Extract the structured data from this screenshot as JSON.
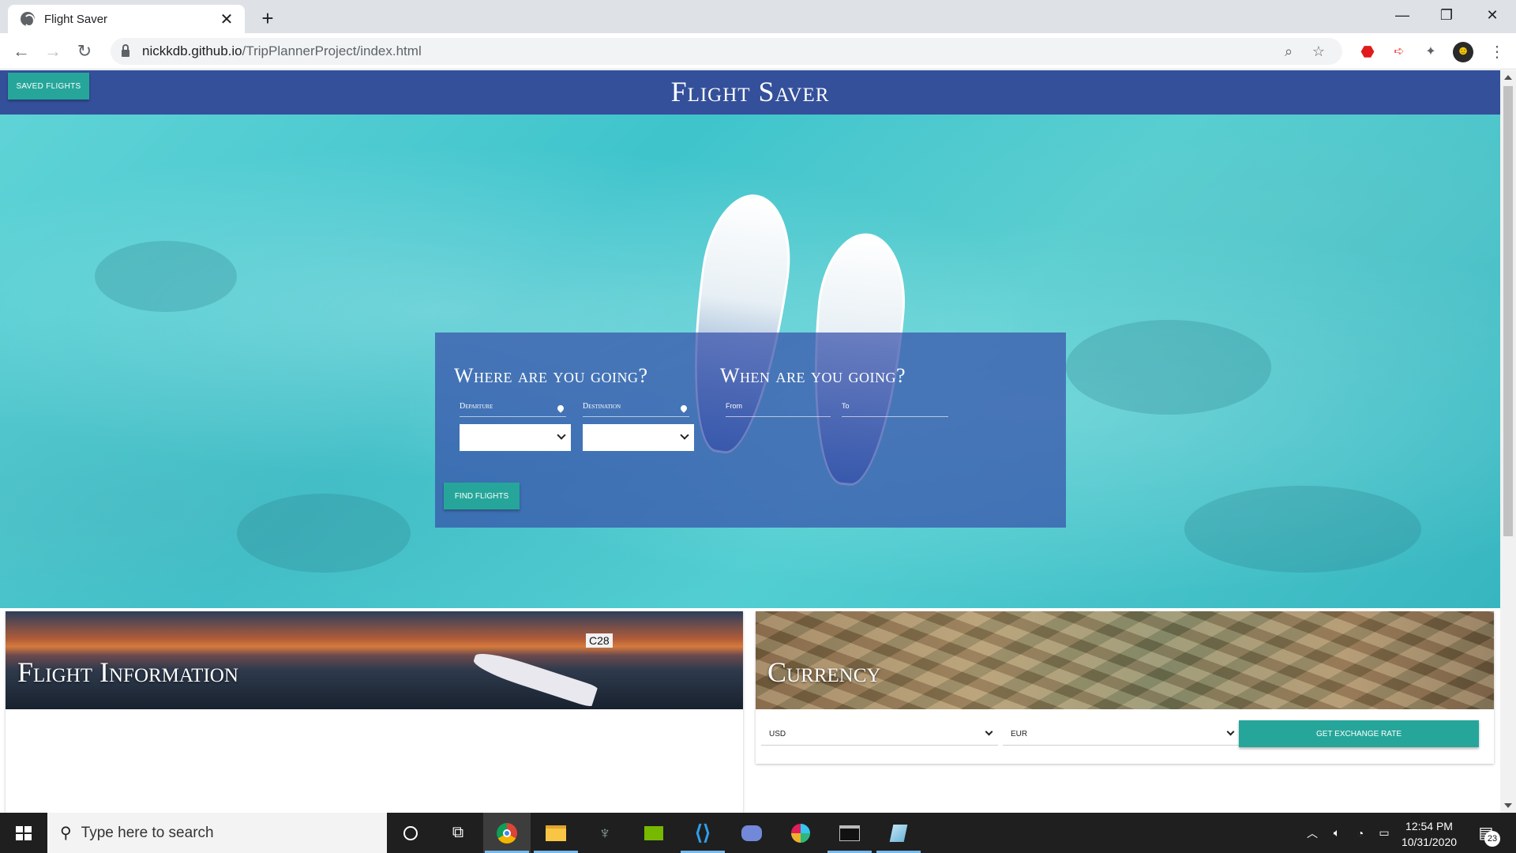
{
  "browser": {
    "tab_title": "Flight Saver",
    "url_host": "nickkdb.github.io",
    "url_path": "/TripPlannerProject/index.html"
  },
  "header": {
    "saved_flights_label": "SAVED FLIGHTS",
    "site_title": "Flight Saver"
  },
  "search": {
    "where_heading": "Where are you going?",
    "when_heading": "When are you going?",
    "departure_label": "Departure",
    "destination_label": "Destination",
    "from_label": "From",
    "to_label": "To",
    "departure_value": "",
    "destination_value": "",
    "find_flights_label": "FIND FLIGHTS"
  },
  "cards": {
    "flight_info_title": "Flight Information",
    "currency_title": "Currency",
    "from_currency": "USD",
    "to_currency": "EUR",
    "exchange_button_label": "GET EXCHANGE RATE"
  },
  "taskbar": {
    "search_placeholder": "Type here to search",
    "time": "12:54 PM",
    "date": "10/31/2020",
    "notification_count": "23"
  },
  "colors": {
    "header_bg": "#34509a",
    "button_teal": "#26a69a",
    "panel_bg": "rgba(55,80,170,0.72)"
  }
}
